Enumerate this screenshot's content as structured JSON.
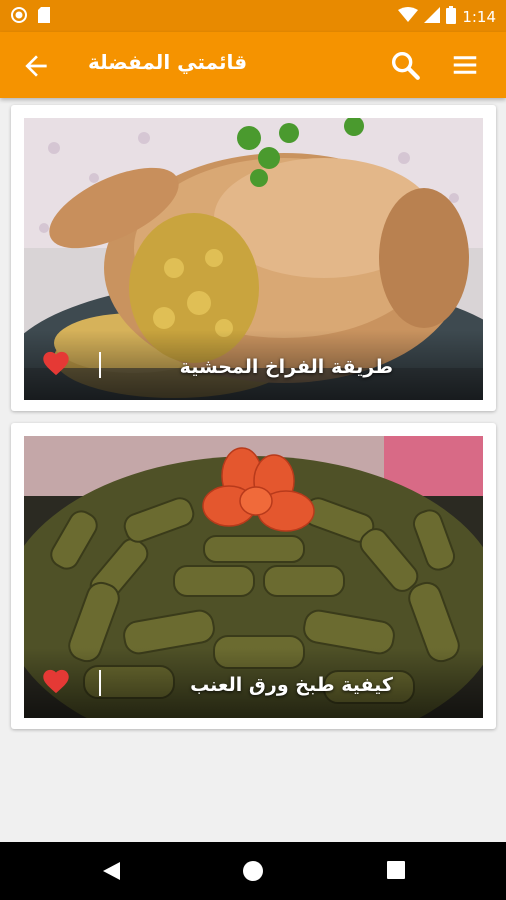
{
  "status_bar": {
    "time": "1:14",
    "icons": [
      "circle-notification-icon",
      "sd-card-icon",
      "wifi-icon",
      "signal-icon",
      "battery-icon"
    ]
  },
  "app_bar": {
    "title": "قائمتي المفضلة",
    "icons": [
      "back-arrow-icon",
      "search-icon",
      "menu-icon"
    ],
    "color": "#f59300"
  },
  "favorites": [
    {
      "title": "طريقة الفراخ المحشية",
      "favorited": true
    },
    {
      "title": "كيفية طبخ ورق العنب",
      "favorited": true
    }
  ],
  "nav_bar": {
    "icons": [
      "nav-back-icon",
      "nav-home-icon",
      "nav-recents-icon"
    ]
  },
  "colors": {
    "accent": "#f59300",
    "heart": "#e53935"
  }
}
